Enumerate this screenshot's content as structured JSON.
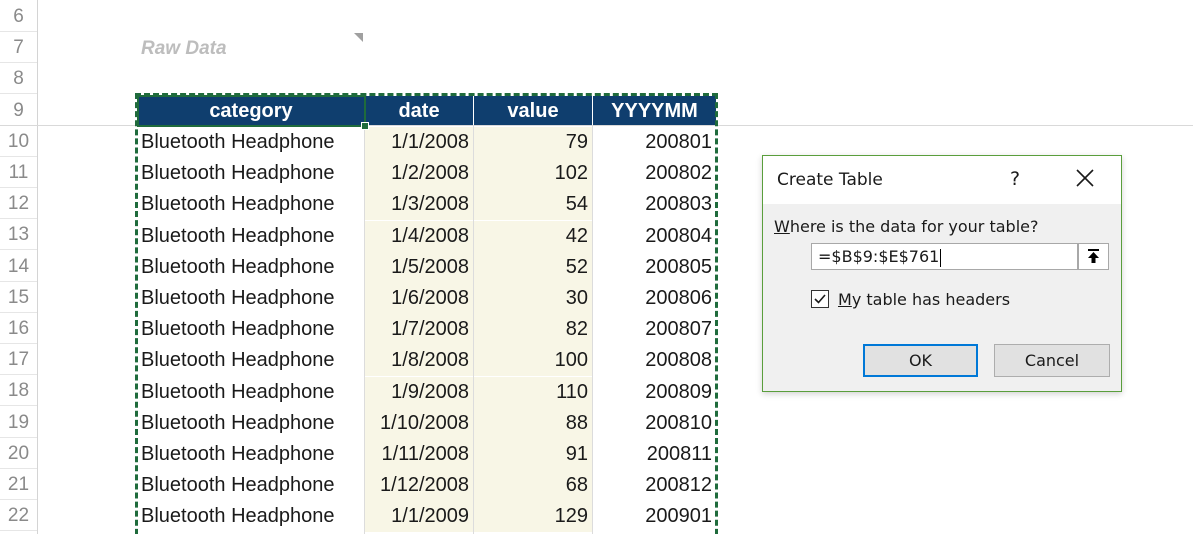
{
  "sheet": {
    "row_numbers": [
      "6",
      "7",
      "8",
      "9",
      "10",
      "11",
      "12",
      "13",
      "14",
      "15",
      "16",
      "17",
      "18",
      "19",
      "20",
      "21",
      "22"
    ],
    "raw_data_label": "Raw Data",
    "headers": {
      "category": "category",
      "date": "date",
      "value": "value",
      "yyyymm": "YYYYMM"
    },
    "rows": [
      {
        "category": "Bluetooth Headphone",
        "date": "1/1/2008",
        "value": "79",
        "yyyymm": "200801"
      },
      {
        "category": "Bluetooth Headphone",
        "date": "1/2/2008",
        "value": "102",
        "yyyymm": "200802"
      },
      {
        "category": "Bluetooth Headphone",
        "date": "1/3/2008",
        "value": "54",
        "yyyymm": "200803"
      },
      {
        "category": "Bluetooth Headphone",
        "date": "1/4/2008",
        "value": "42",
        "yyyymm": "200804"
      },
      {
        "category": "Bluetooth Headphone",
        "date": "1/5/2008",
        "value": "52",
        "yyyymm": "200805"
      },
      {
        "category": "Bluetooth Headphone",
        "date": "1/6/2008",
        "value": "30",
        "yyyymm": "200806"
      },
      {
        "category": "Bluetooth Headphone",
        "date": "1/7/2008",
        "value": "82",
        "yyyymm": "200807"
      },
      {
        "category": "Bluetooth Headphone",
        "date": "1/8/2008",
        "value": "100",
        "yyyymm": "200808"
      },
      {
        "category": "Bluetooth Headphone",
        "date": "1/9/2008",
        "value": "110",
        "yyyymm": "200809"
      },
      {
        "category": "Bluetooth Headphone",
        "date": "1/10/2008",
        "value": "88",
        "yyyymm": "200810"
      },
      {
        "category": "Bluetooth Headphone",
        "date": "1/11/2008",
        "value": "91",
        "yyyymm": "200811"
      },
      {
        "category": "Bluetooth Headphone",
        "date": "1/12/2008",
        "value": "68",
        "yyyymm": "200812"
      },
      {
        "category": "Bluetooth Headphone",
        "date": "1/1/2009",
        "value": "129",
        "yyyymm": "200901"
      }
    ],
    "colors": {
      "header_bg": "#0f3e6e",
      "date_value_fill": "#f8f6e6",
      "selection_marquee": "#1f6b3c"
    }
  },
  "dialog": {
    "title": "Create Table",
    "help_label": "?",
    "close_icon": "close-icon",
    "prompt_prefix": "W",
    "prompt_rest": "here is the data for your table?",
    "range_value": "=$B$9:$E$761",
    "collapse_icon": "collapse-dialog-icon",
    "checkbox_checked": true,
    "checkbox_label_prefix": "M",
    "checkbox_label_rest": "y table has headers",
    "ok_label": "OK",
    "cancel_label": "Cancel",
    "border_color": "#5a9e3c"
  }
}
